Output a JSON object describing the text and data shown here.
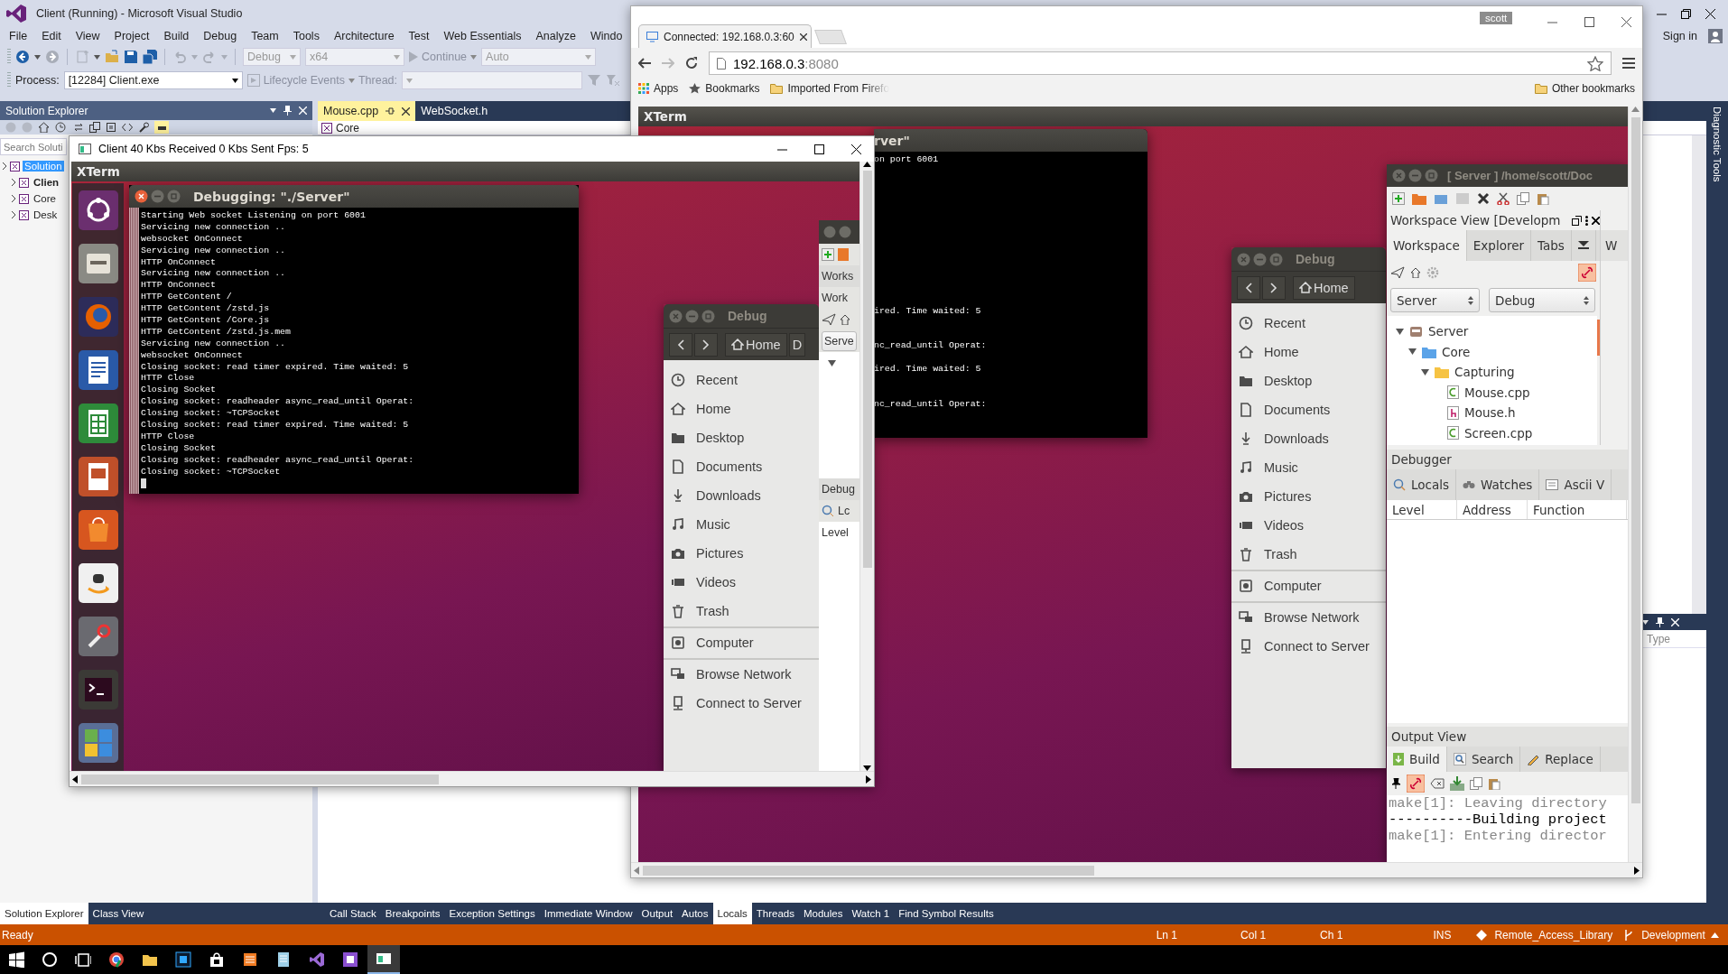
{
  "vs": {
    "title": "Client (Running) - Microsoft Visual Studio",
    "menu": [
      "File",
      "Edit",
      "View",
      "Project",
      "Build",
      "Debug",
      "Team",
      "Tools",
      "Architecture",
      "Test",
      "Web Essentials",
      "Analyze",
      "Windo"
    ],
    "sign_in": "Sign in",
    "toolbar": {
      "configuration": "Debug",
      "platform": "x64",
      "continue": "Continue",
      "engine": "Auto",
      "process_label": "Process:",
      "process": "[12284] Client.exe",
      "lifecycle": "Lifecycle Events",
      "thread_label": "Thread:"
    },
    "solution_explorer": {
      "title": "Solution Explorer",
      "search": {
        "placeholder": "Search Soluti"
      },
      "tree": [
        {
          "label": "Solution",
          "selected": true,
          "bold": false,
          "children": [
            {
              "label": "Clien",
              "selected": false,
              "bold": true
            },
            {
              "label": "Core",
              "selected": false,
              "bold": false
            },
            {
              "label": "Desk",
              "selected": false,
              "bold": false
            }
          ]
        }
      ]
    },
    "editor_tabs": [
      {
        "label": "Mouse.cpp",
        "selected": true
      },
      {
        "label": "WebSocket.h",
        "selected": false
      }
    ],
    "navigation": "Core",
    "side_tab": "Diagnostic Tools",
    "side_pane": {
      "column": "Type"
    },
    "left_tabs": [
      {
        "label": "Solution Explorer",
        "selected": true
      },
      {
        "label": "Class View",
        "selected": false
      }
    ],
    "bottom_tabs": [
      {
        "label": "Call Stack",
        "selected": false
      },
      {
        "label": "Breakpoints",
        "selected": false
      },
      {
        "label": "Exception Settings",
        "selected": false
      },
      {
        "label": "Immediate Window",
        "selected": false
      },
      {
        "label": "Output",
        "selected": false
      },
      {
        "label": "Autos",
        "selected": false
      },
      {
        "label": "Locals",
        "selected": true
      },
      {
        "label": "Threads",
        "selected": false
      },
      {
        "label": "Modules",
        "selected": false
      },
      {
        "label": "Watch 1",
        "selected": false
      },
      {
        "label": "Find Symbol Results",
        "selected": false
      }
    ],
    "status": {
      "state": "Ready",
      "line": "Ln 1",
      "column": "Col 1",
      "char": "Ch 1",
      "mode": "INS",
      "repository": "Remote_Access_Library",
      "branch": "Development"
    }
  },
  "taskbar": {
    "buttons": [
      {
        "selected": false
      },
      {
        "selected": false
      },
      {
        "selected": false
      },
      {
        "selected": false
      },
      {
        "selected": false
      },
      {
        "selected": false
      },
      {
        "selected": false
      },
      {
        "selected": false
      },
      {
        "selected": false
      },
      {
        "selected": false
      },
      {
        "selected": false
      },
      {
        "selected": true
      }
    ]
  },
  "client": {
    "title": "Client 40 Kbs Received 0 Kbs Sent Fps: 5",
    "xterm": "XTerm",
    "terminal": {
      "title": "Debugging: \"./Server\"",
      "lines": [
        "Starting Web socket Listening on port 6001",
        "Servicing new connection ..",
        "websocket OnConnect",
        "Servicing new connection ..",
        "HTTP OnConnect",
        "Servicing new connection ..",
        "HTTP OnConnect",
        "HTTP GetContent /",
        "HTTP GetContent /zstd.js",
        "HTTP GetContent /Core.js",
        "HTTP GetContent /zstd.js.mem",
        "Servicing new connection ..",
        "websocket OnConnect",
        "Closing socket: read timer expired. Time waited: 5",
        "HTTP Close",
        "Closing Socket",
        "Closing socket: readheader async_read_until Operat:",
        "Closing socket: ~TCPSocket",
        "Closing socket: read timer expired. Time waited: 5",
        "HTTP Close",
        "Closing Socket",
        "Closing socket: readheader async_read_until Operat:",
        "Closing socket: ~TCPSocket"
      ]
    },
    "files": {
      "title": "Debug",
      "location": "Home",
      "next_location": "D",
      "groups": [
        {
          "items": [
            "Recent",
            "Home",
            "Desktop",
            "Documents",
            "Downloads",
            "Music",
            "Pictures",
            "Videos",
            "Trash"
          ]
        },
        {
          "items": [
            "Computer"
          ]
        },
        {
          "items": [
            "Browse Network",
            "Connect to Server"
          ]
        }
      ]
    },
    "codelite": {
      "pane_title": "Works",
      "tab": "Work",
      "project": "Serve",
      "debugger": "Debug",
      "debugger_tab": "Lc",
      "column": "Level"
    }
  },
  "browser": {
    "tab": "Connected: 192.168.0.3:60",
    "profile": "scott",
    "address": {
      "host": "192.168.0.3",
      "port": ":8080"
    },
    "bookmarks": [
      "Apps",
      "Bookmarks",
      "Imported From Firefo"
    ],
    "other_bookmarks": "Other bookmarks",
    "xterm": "XTerm",
    "terminal": {
      "title": "rver\"",
      "lines": [
        "on port 6001",
        "ired. Time waited: 5",
        "nc_read_until Operat:",
        "ired. Time waited: 5",
        "nc_read_until Operat:"
      ]
    },
    "files": {
      "title": "Debug",
      "location": "Home",
      "groups": [
        {
          "items": [
            "Recent",
            "Home",
            "Desktop",
            "Documents",
            "Downloads",
            "Music",
            "Pictures",
            "Videos",
            "Trash"
          ]
        },
        {
          "items": [
            "Computer"
          ]
        },
        {
          "items": [
            "Browse Network",
            "Connect to Server"
          ]
        }
      ]
    },
    "codelite": {
      "title": "[ Server ] /home/scott/Doc",
      "workspace_title": "Workspace View [Developm",
      "side_tab": "W",
      "tabs": [
        {
          "label": "Workspace",
          "selected": true
        },
        {
          "label": "Explorer",
          "selected": false
        },
        {
          "label": "Tabs",
          "selected": false
        }
      ],
      "project": "Server",
      "configuration": "Debug",
      "tree": [
        {
          "label": "Server",
          "kind": "project",
          "expanded": true,
          "children": [
            {
              "label": "Core",
              "kind": "folder",
              "expanded": true,
              "children": [
                {
                  "label": "Capturing",
                  "kind": "folder",
                  "expanded": true,
                  "children": [
                    {
                      "label": "Mouse.cpp",
                      "kind": "source"
                    },
                    {
                      "label": "Mouse.h",
                      "kind": "header"
                    },
                    {
                      "label": "Screen.cpp",
                      "kind": "source"
                    }
                  ]
                }
              ]
            }
          ]
        }
      ],
      "debugger": "Debugger",
      "debugger_tabs": [
        "Locals",
        "Watches",
        "Ascii V"
      ],
      "columns": [
        "Level",
        "Address",
        "Function"
      ],
      "output": "Output View",
      "output_tabs": [
        {
          "label": "Build",
          "selected": true
        },
        {
          "label": "Search",
          "selected": false
        },
        {
          "label": "Replace",
          "selected": false
        }
      ],
      "output_lines": [
        {
          "text": "make[1]: Leaving directory",
          "kind": "info"
        },
        {
          "text": "----------Building project",
          "kind": "heading"
        },
        {
          "text": "make[1]: Entering director",
          "kind": "info"
        }
      ]
    }
  }
}
